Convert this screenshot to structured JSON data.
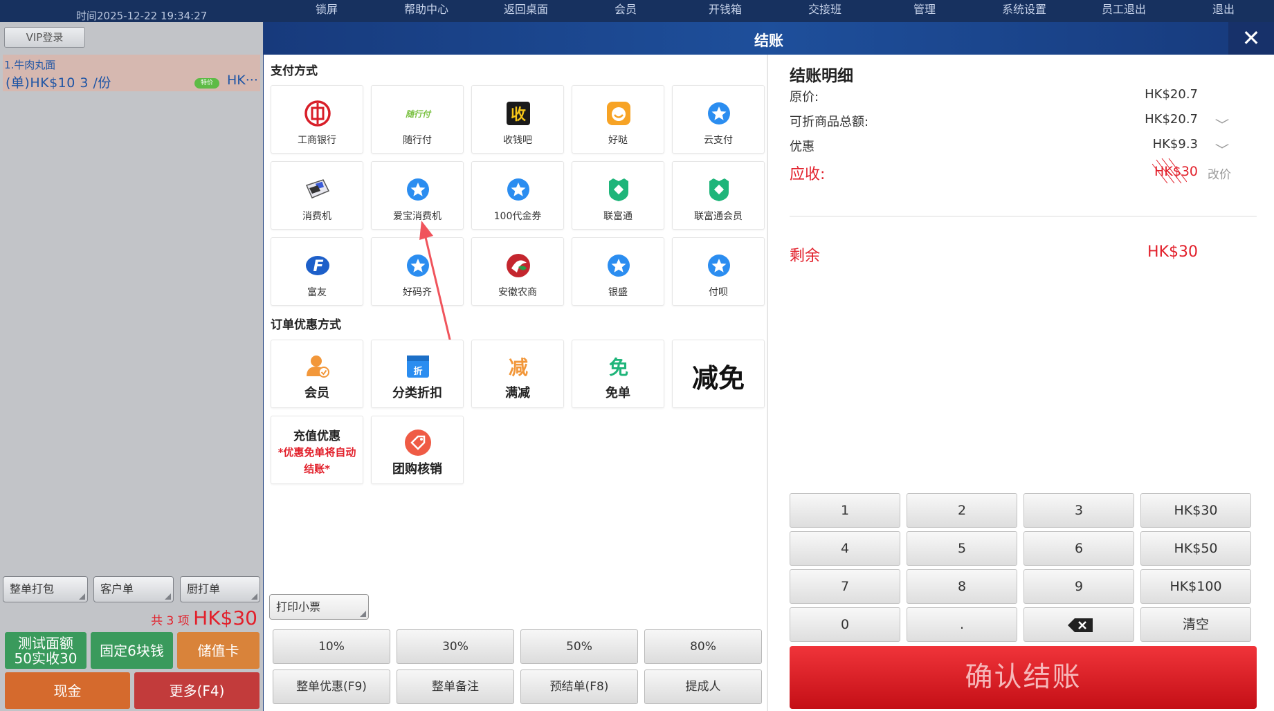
{
  "topbar": {
    "time": "时间2025-12-22 19:34:27",
    "nav": [
      "锁屏",
      "帮助中心",
      "返回桌面",
      "会员",
      "开钱箱",
      "交接班",
      "管理",
      "系统设置",
      "员工退出",
      "退出"
    ]
  },
  "left": {
    "vip_login": "VIP登录",
    "order_item": {
      "name": "1.牛肉丸面",
      "price_line": "(单)HK$10  3 /份",
      "tag": "特价",
      "amount": "HK···"
    },
    "buttons": {
      "pack": "整单打包",
      "customer": "客户单",
      "kitchen": "厨打单"
    },
    "total": {
      "prefix": "共",
      "count": "3",
      "unit": "项",
      "amount": "HK$30"
    },
    "bottom": {
      "test_line1": "测试面额",
      "test_line2": "50实收30",
      "fixed": "固定6块钱",
      "stored_card": "储值卡",
      "cash": "现金",
      "more": "更多(F4)"
    },
    "colors": {
      "green": "#3a9a5c",
      "orange": "#d9833a",
      "cash": "#d56a2d",
      "more": "#c23b3b"
    }
  },
  "modal": {
    "title": "结账",
    "close": "✕",
    "payment_title": "支付方式",
    "payments": [
      {
        "label": "工商银行",
        "icon": "icbc-icon"
      },
      {
        "label": "随行付",
        "icon": "suixingfu-icon"
      },
      {
        "label": "收钱吧",
        "icon": "shouqianba-icon"
      },
      {
        "label": "好哒",
        "icon": "haoda-icon"
      },
      {
        "label": "云支付",
        "icon": "star-icon"
      },
      {
        "label": "消费机",
        "icon": "pos-machine-icon"
      },
      {
        "label": "爱宝消费机",
        "icon": "star-icon"
      },
      {
        "label": "100代金券",
        "icon": "star-icon"
      },
      {
        "label": "联富通",
        "icon": "lianfutong-icon"
      },
      {
        "label": "联富通会员",
        "icon": "lianfutong-icon"
      },
      {
        "label": "富友",
        "icon": "fuyou-icon"
      },
      {
        "label": "好码齐",
        "icon": "star-icon"
      },
      {
        "label": "安徽农商",
        "icon": "anhui-bank-icon"
      },
      {
        "label": "银盛",
        "icon": "star-icon"
      },
      {
        "label": "付呗",
        "icon": "star-icon"
      }
    ],
    "discount_title": "订单优惠方式",
    "discounts": {
      "member": "会员",
      "category": "分类折扣",
      "category_icon_text": "折",
      "full_reduction": "满减",
      "full_reduction_icon_text": "减",
      "free": "免单",
      "free_icon_text": "免",
      "waive": "减免",
      "recharge_title": "充值优惠",
      "recharge_note": "*优惠免单将自动结账*",
      "group_buy": "团购核销"
    },
    "print_ticket": "打印小票",
    "percent_buttons": [
      "10%",
      "30%",
      "50%",
      "80%"
    ],
    "action_buttons": [
      "整单优惠(F9)",
      "整单备注",
      "预结单(F8)",
      "提成人"
    ]
  },
  "summary": {
    "title": "结账明细",
    "original_label": "原价:",
    "original_value": "HK$20.7",
    "discountable_label": "可折商品总额:",
    "discountable_value": "HK$20.7",
    "discount_label": "优惠",
    "discount_value": "HK$9.3",
    "receivable_label": "应收:",
    "receivable_value": "HK$30",
    "change_price": "改价",
    "remaining_label": "剩余",
    "remaining_value": "HK$30"
  },
  "keypad": {
    "keys": [
      "1",
      "2",
      "3",
      "HK$30",
      "4",
      "5",
      "6",
      "HK$50",
      "7",
      "8",
      "9",
      "HK$100",
      "0",
      ".",
      "⌫",
      "清空"
    ],
    "confirm": "确认结账"
  }
}
